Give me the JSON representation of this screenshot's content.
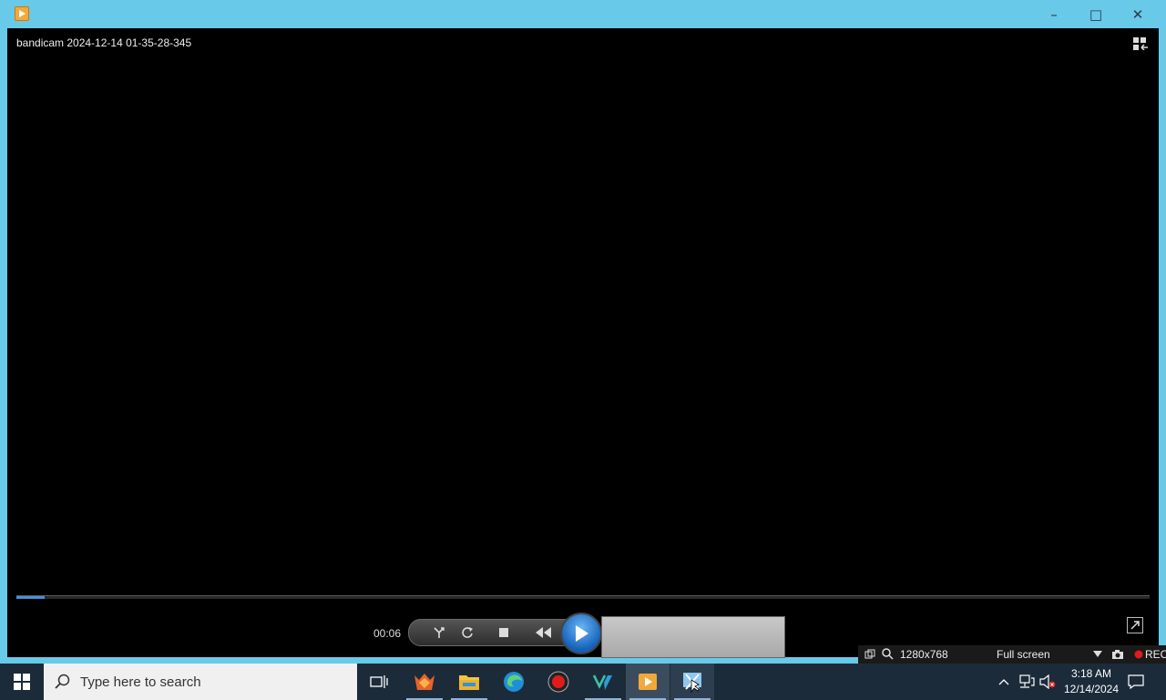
{
  "window": {
    "title_icon": "player-app-icon",
    "minimize": "–",
    "maximize": "□",
    "close": "✕"
  },
  "player": {
    "video_title": "bandicam 2024-12-14 01-35-28-345",
    "current_time": "00:06",
    "progress": 0.025
  },
  "bandicam_bar": {
    "resolution": "1280x768",
    "mode": "Full screen",
    "rec_label": "REC"
  },
  "taskbar": {
    "search_placeholder": "Type here to search",
    "apps": [
      "task-view",
      "firefox-dev",
      "file-explorer",
      "edge",
      "recorder",
      "visual-studio",
      "media-player",
      "snipping-tool"
    ],
    "time": "3:18 AM",
    "date": "12/14/2024"
  },
  "colors": {
    "titlebar": "#69c9e8",
    "video_bg": "#000000",
    "play_button": "#1e78d6",
    "taskbar": "#1c2b3a"
  }
}
